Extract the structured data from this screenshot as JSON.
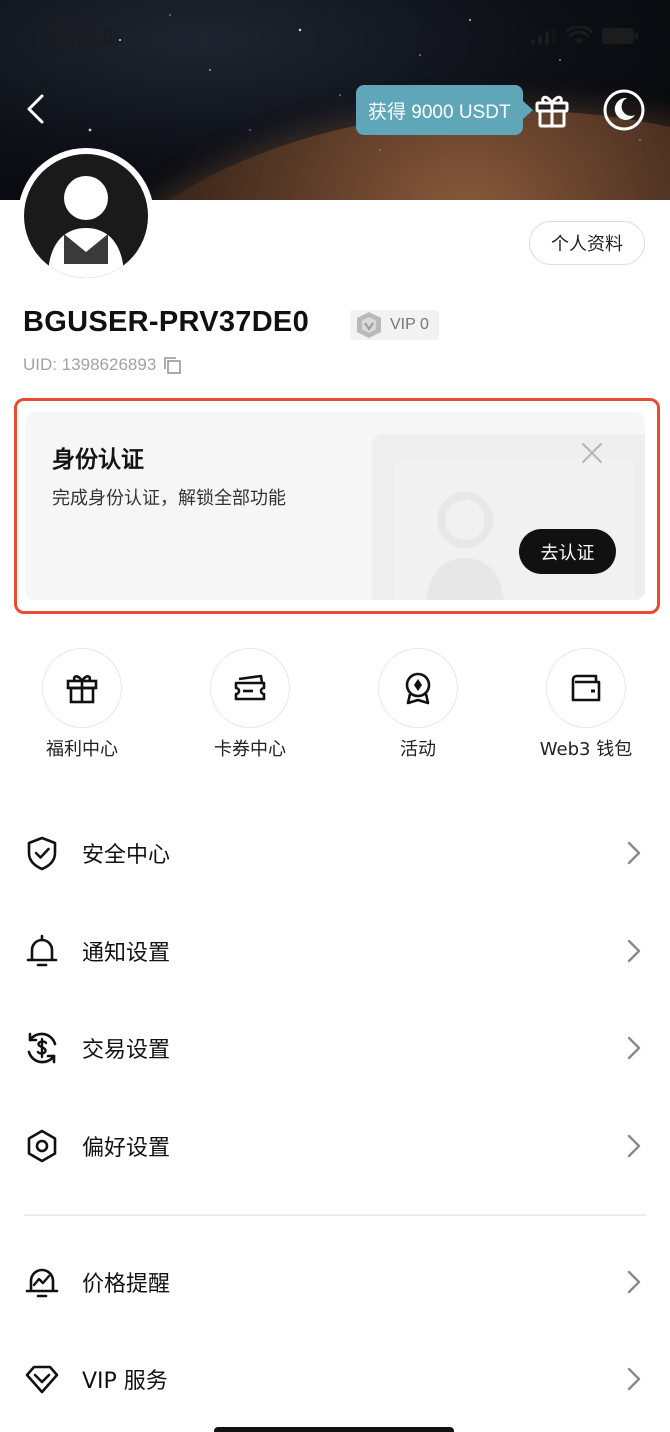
{
  "status_bar": {
    "time": "15:14"
  },
  "header": {
    "reward_text": "获得 9000 USDT"
  },
  "profile": {
    "edit_button": "个人资料",
    "username": "BGUSER-PRV37DE0",
    "vip_label": "VIP 0",
    "uid": "UID: 1398626893"
  },
  "kyc_card": {
    "title": "身份认证",
    "subtitle": "完成身份认证，解锁全部功能",
    "button": "去认证"
  },
  "quick_actions": [
    {
      "label": "福利中心",
      "icon": "gift-icon"
    },
    {
      "label": "卡券中心",
      "icon": "ticket-icon"
    },
    {
      "label": "活动",
      "icon": "badge-icon"
    },
    {
      "label": "Web3 钱包",
      "icon": "wallet-icon"
    }
  ],
  "menu": [
    {
      "label": "安全中心",
      "icon": "shield-check-icon"
    },
    {
      "label": "通知设置",
      "icon": "bell-icon"
    },
    {
      "label": "交易设置",
      "icon": "dollar-exchange-icon"
    },
    {
      "label": "偏好设置",
      "icon": "hexagon-settings-icon"
    },
    {
      "label": "价格提醒",
      "icon": "price-alert-icon"
    },
    {
      "label": "VIP 服务",
      "icon": "diamond-icon"
    }
  ],
  "colors": {
    "reward_pill": "#5fa7b8",
    "highlight_outline": "#e84a32",
    "primary_button": "#111111"
  }
}
